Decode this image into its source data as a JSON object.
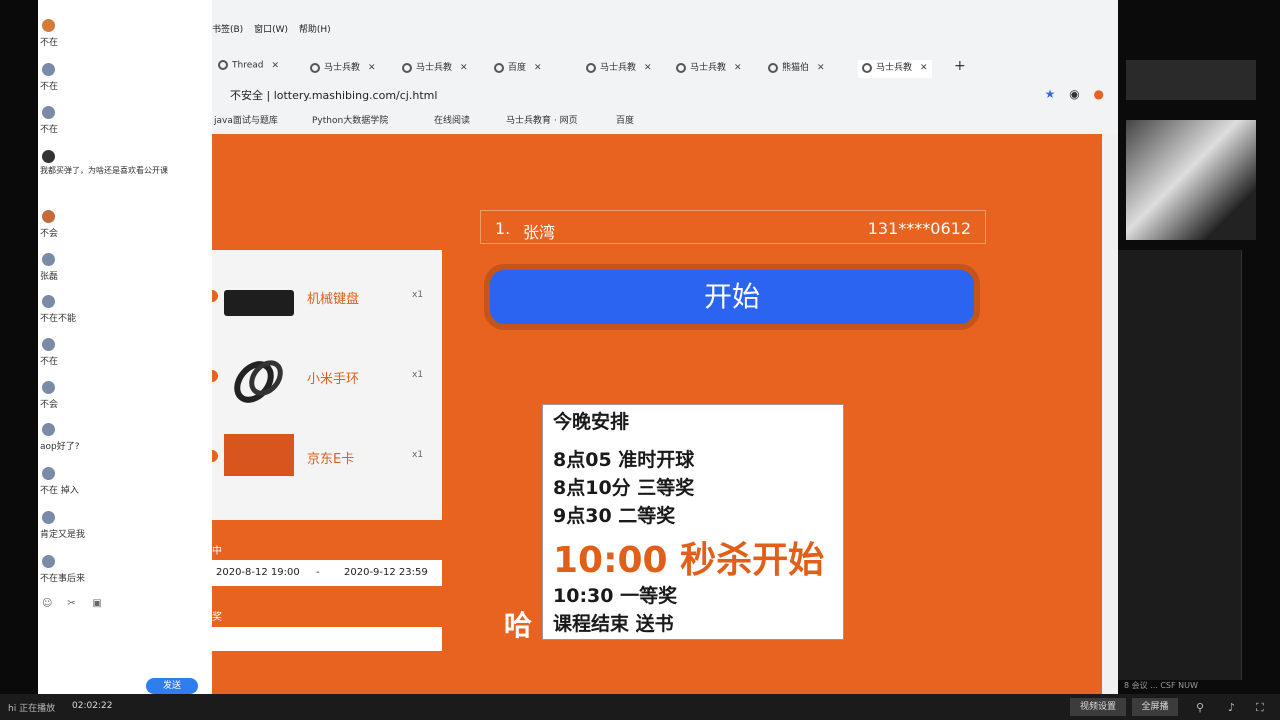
{
  "chat": {
    "items": [
      {
        "name": "",
        "status": "不在"
      },
      {
        "name": "",
        "status": "不在"
      },
      {
        "name": "",
        "status": "不在"
      },
      {
        "name": "",
        "status": "我都买弹了，为啥还是喜欢看公开课"
      },
      {
        "name": "",
        "status": "不会"
      },
      {
        "name": "",
        "status": "张磊"
      },
      {
        "name": "",
        "status": "不在不能"
      },
      {
        "name": "",
        "status": "不在"
      },
      {
        "name": "",
        "status": "不会"
      },
      {
        "name": "",
        "status": "aop好了?"
      },
      {
        "name": "",
        "status": "不在 掉入"
      },
      {
        "name": "",
        "status": "肯定又是我"
      },
      {
        "name": "",
        "status": "不在事后来"
      }
    ],
    "send_label": "发送"
  },
  "browser": {
    "menu": [
      "书签(B)",
      "窗口(W)",
      "帮助(H)"
    ],
    "tabs": [
      "Thread",
      "马士兵教",
      "马士兵教",
      "百度",
      "马士兵教",
      "马士兵教",
      "熊猫伯",
      "马士兵教"
    ],
    "address": "不安全 | lottery.mashibing.com/cj.html",
    "bookmarks": [
      "java面试与题库",
      "Python大数据学院",
      "在线阅读",
      "马士兵教育 · 网页",
      "百度"
    ]
  },
  "page": {
    "prizes": [
      {
        "name": "机械键盘",
        "qty": "x1",
        "color": "#222222"
      },
      {
        "name": "小米手环",
        "qty": "x1",
        "color": "#333333"
      },
      {
        "name": "京东E卡",
        "qty": "x1",
        "color": "#d8561d"
      }
    ],
    "date_label": "中",
    "date_start": "2020-8-12 19:00",
    "date_sep": "-",
    "date_end": "2020-9-12 23:59",
    "date_label2": "奖",
    "winner": {
      "rank": "1.",
      "name": "张湾",
      "phone": "131****0612"
    },
    "start_label": "开始",
    "schedule": {
      "title": "今晚安排",
      "lines": [
        "8点05 准时开球",
        "8点10分 三等奖",
        "9点30 二等奖"
      ],
      "highlight": "10:00 秒杀开始",
      "after": [
        "10:30 一等奖",
        "课程结束 送书"
      ]
    },
    "overlay": "哈"
  },
  "taskbar": {
    "left": "hi 正在播放",
    "time": "02:02:22",
    "btn1": "视频设置",
    "btn2": "全屏播",
    "status": "8 会议 ...  CSF  NUW"
  }
}
